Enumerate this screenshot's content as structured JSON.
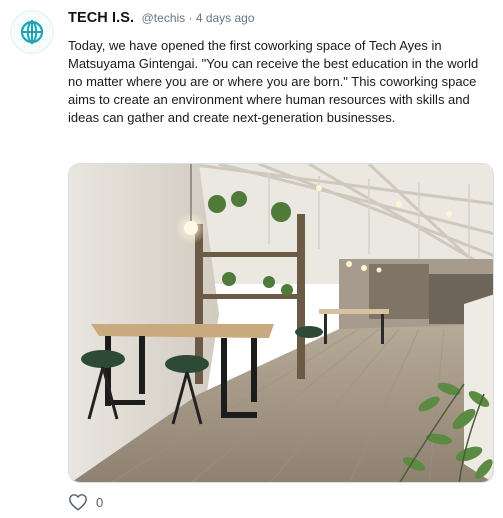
{
  "post": {
    "author": {
      "name": "TECH I.S.",
      "handle": "@techis",
      "avatar_icon": "globe-icon",
      "brand_color": "#1aa7b3"
    },
    "meta": "@techis · 4 days ago",
    "text": "Today, we have opened the first coworking space of Tech Ayes in Matsuyama Gintengai. \"You can receive the best education in the world no matter where you are or where you are born.\" This coworking space aims to create an environment where human resources with skills and ideas can gather and create next-generation businesses.",
    "like_count": "0",
    "like_icon": "heart-icon"
  }
}
